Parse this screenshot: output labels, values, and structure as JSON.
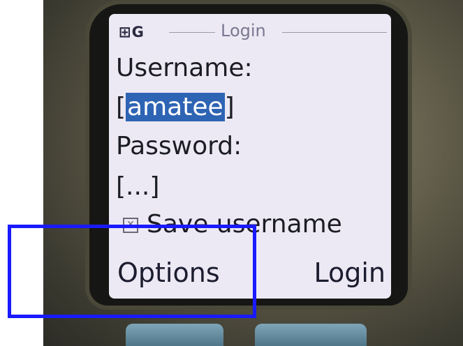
{
  "status": {
    "signal": "⊞G"
  },
  "screen": {
    "title": "Login"
  },
  "form": {
    "username_label": "Username:",
    "username_open": "[",
    "username_value": "amatee",
    "username_close": "]",
    "password_label": "Password:",
    "password_value": "[...]",
    "save_username_label": "Save username",
    "save_username_checked": true
  },
  "softkeys": {
    "left": "Options",
    "right": "Login"
  },
  "colors": {
    "highlight": "#1a1aff",
    "selection": "#2e64b4",
    "screen_bg": "#ece9f4"
  }
}
